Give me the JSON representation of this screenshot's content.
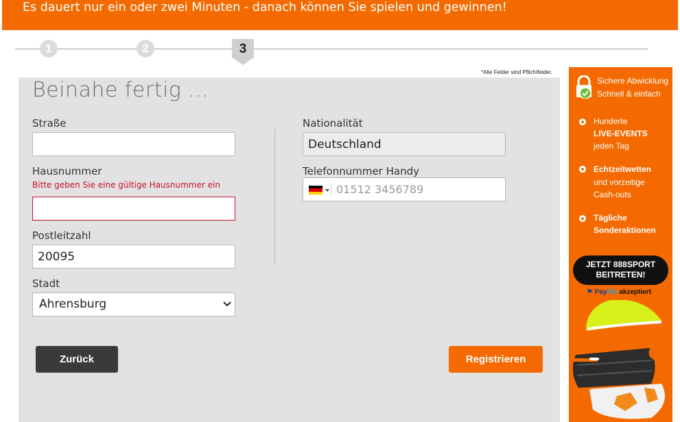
{
  "banner": {
    "text": "Es dauert nur ein oder zwei Minuten - danach können Sie spielen und gewinnen!"
  },
  "steps": {
    "items": [
      "1",
      "2",
      "3"
    ],
    "active": "3"
  },
  "form": {
    "required_note": "*Alle Felder sind Pflichtfelder.",
    "title": "Beinahe fertig ...",
    "street": {
      "label": "Straße",
      "value": ""
    },
    "house_number": {
      "label": "Hausnummer",
      "error": "Bitte geben Sie eine gültige Hausnummer ein",
      "value": ""
    },
    "postal_code": {
      "label": "Postleitzahl",
      "value": "20095"
    },
    "city": {
      "label": "Stadt",
      "value": "Ahrensburg"
    },
    "nationality": {
      "label": "Nationalität",
      "value": "Deutschland"
    },
    "phone": {
      "label": "Telefonnummer Handy",
      "placeholder": "01512 3456789",
      "country": "DE"
    }
  },
  "buttons": {
    "back": "Zurück",
    "register": "Registrieren"
  },
  "promo": {
    "secure_line1": "Sichere Abwicklung",
    "secure_line2": "Schnell & einfach",
    "bullets": [
      {
        "normal_before": "Hunderte",
        "bold": "LIVE-EVENTS",
        "normal_after": "jeden Tag"
      },
      {
        "bold": "Echtzeitwetten",
        "normal_after_1": "und vorzeitige",
        "normal_after_2": "Cash-outs"
      },
      {
        "bold_1": "Tägliche",
        "bold_2": "Sonderaktionen"
      }
    ],
    "join_line1": "JETZT 888SPORT",
    "join_line2": "BEITRETEN!",
    "paypal_brand_1": "Pay",
    "paypal_brand_2": "Pal",
    "paypal_text": "akzeptiert"
  },
  "colors": {
    "accent": "#f46a00",
    "panel": "#e2e2e2",
    "error": "#c8102e",
    "dark_button": "#3a3a3a"
  }
}
